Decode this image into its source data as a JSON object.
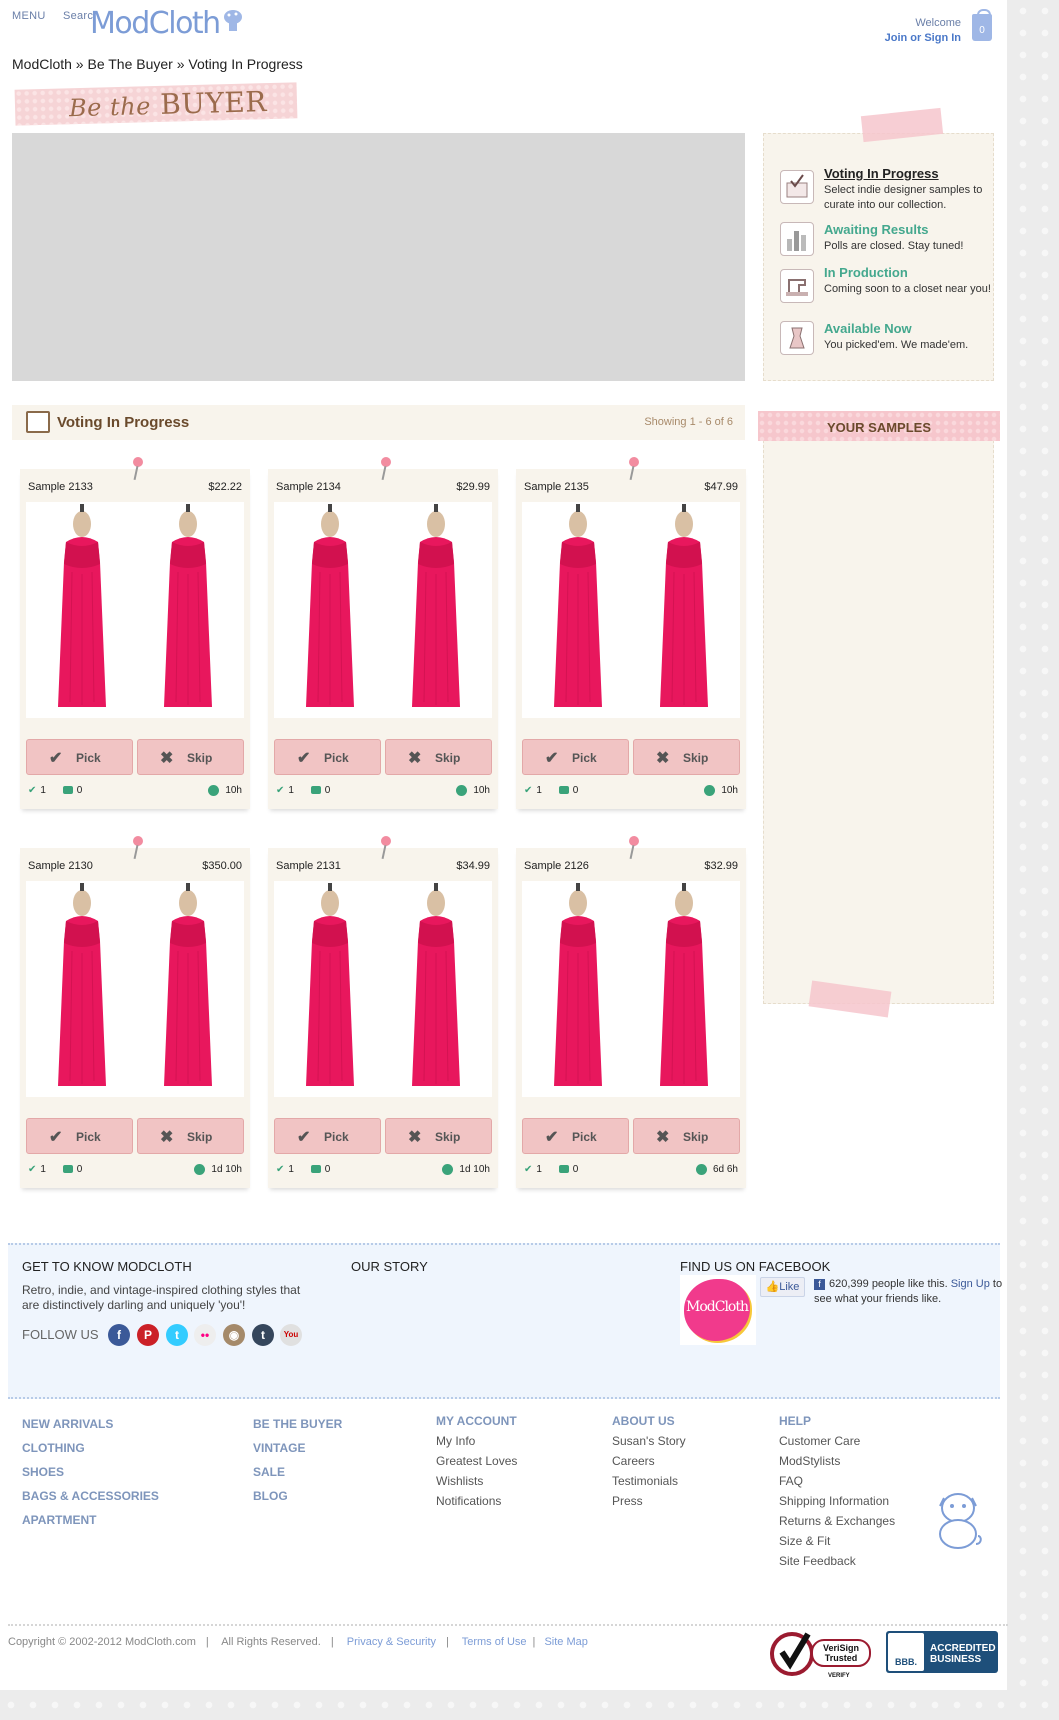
{
  "header": {
    "menu": "MENU",
    "search": "Search",
    "logo": "ModCloth",
    "welcome": "Welcome",
    "join": "Join or Sign In",
    "bag_count": "0"
  },
  "breadcrumb": "ModCloth » Be The Buyer » Voting In Progress",
  "banner": {
    "be_the": "Be the",
    "buyer": "BUYER"
  },
  "steps": [
    {
      "title": "Voting In Progress",
      "desc": "Select indie designer samples to curate into our collection.",
      "icon": "ballot-icon"
    },
    {
      "title": "Awaiting Results",
      "desc": "Polls are closed. Stay tuned!",
      "icon": "bar-chart-icon"
    },
    {
      "title": "In Production",
      "desc": "Coming soon to a closet near you!",
      "icon": "sewing-machine-icon"
    },
    {
      "title": "Available Now",
      "desc": "You picked'em. We made'em.",
      "icon": "dress-form-icon"
    }
  ],
  "voting": {
    "title": "Voting In Progress",
    "showing": "Showing 1 - 6 of 6"
  },
  "your_samples": "YOUR SAMPLES",
  "pick_label": "Pick",
  "skip_label": "Skip",
  "cards": [
    {
      "name": "Sample 2133",
      "price": "$22.22",
      "picks": "1",
      "comments": "0",
      "time": "10h"
    },
    {
      "name": "Sample 2134",
      "price": "$29.99",
      "picks": "1",
      "comments": "0",
      "time": "10h"
    },
    {
      "name": "Sample 2135",
      "price": "$47.99",
      "picks": "1",
      "comments": "0",
      "time": "10h"
    },
    {
      "name": "Sample 2130",
      "price": "$350.00",
      "picks": "1",
      "comments": "0",
      "time": "1d 10h"
    },
    {
      "name": "Sample 2131",
      "price": "$34.99",
      "picks": "1",
      "comments": "0",
      "time": "1d 10h"
    },
    {
      "name": "Sample 2126",
      "price": "$32.99",
      "picks": "1",
      "comments": "0",
      "time": "6d 6h"
    }
  ],
  "footer": {
    "get_to_know": "GET TO KNOW MODCLOTH",
    "tagline": "Retro, indie, and vintage-inspired clothing styles that are distinctively darling and uniquely 'you'!",
    "follow": "FOLLOW US",
    "social": [
      "facebook-icon",
      "pinterest-icon",
      "twitter-icon",
      "flickr-icon",
      "instagram-icon",
      "tumblr-icon",
      "youtube-icon"
    ],
    "our_story": "OUR STORY",
    "find_fb": "FIND US ON FACEBOOK",
    "fb_logo": "ModCloth",
    "like": "Like",
    "likes_text": "620,399 people like this.",
    "sign_up": "Sign Up",
    "likes_rest": "to see what your friends like.",
    "shop_col1": [
      "NEW ARRIVALS",
      "CLOTHING",
      "SHOES",
      "BAGS & ACCESSORIES",
      "APARTMENT"
    ],
    "shop_col2": [
      "BE THE BUYER",
      "VINTAGE",
      "SALE",
      "BLOG"
    ],
    "account": {
      "head": "MY ACCOUNT",
      "items": [
        "My Info",
        "Greatest Loves",
        "Wishlists",
        "Notifications"
      ]
    },
    "about": {
      "head": "ABOUT US",
      "items": [
        "Susan's Story",
        "Careers",
        "Testimonials",
        "Press"
      ]
    },
    "help": {
      "head": "HELP",
      "items": [
        "Customer Care",
        "ModStylists",
        "FAQ",
        "Shipping Information",
        "Returns & Exchanges",
        "Size & Fit",
        "Site Feedback"
      ]
    },
    "copyright": "Copyright © 2002-2012 ModCloth.com",
    "rights": "All Rights Reserved.",
    "privacy": "Privacy & Security",
    "terms": "Terms of Use",
    "sitemap": "Site Map",
    "verisign": {
      "line1": "VeriSign",
      "line2": "Trusted",
      "line3": "VERIFY"
    },
    "bbb": {
      "logo": "BBB.",
      "line1": "ACCREDITED",
      "line2": "BUSINESS"
    }
  },
  "colors": {
    "pink": "#f1c4c4",
    "green": "#44a88e",
    "blue": "#7c9cd6",
    "dress": "#e8175d"
  }
}
